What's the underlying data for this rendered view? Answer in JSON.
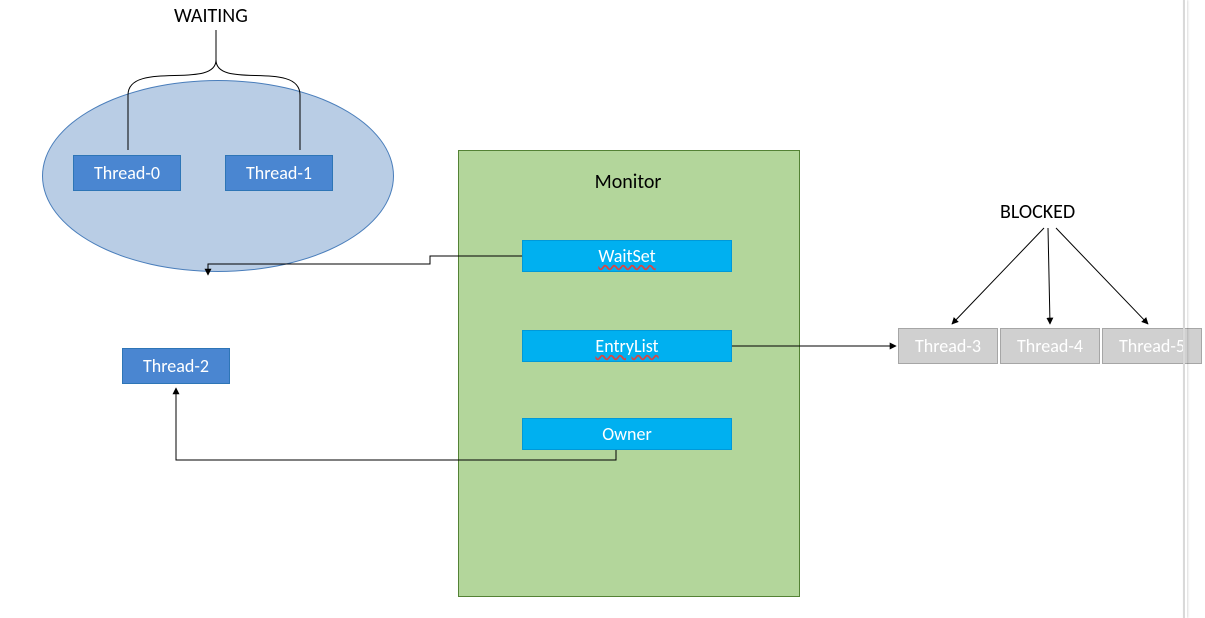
{
  "labels": {
    "waiting": "WAITING",
    "blocked": "BLOCKED",
    "monitor": "Monitor"
  },
  "waitSetGroup": {
    "threads": [
      "Thread-0",
      "Thread-1"
    ]
  },
  "ownerThread": "Thread-2",
  "monitor": {
    "waitset": "WaitSet",
    "entrylist": "EntryList",
    "owner": "Owner"
  },
  "entryListGroup": {
    "threads": [
      "Thread-3",
      "Thread-4",
      "Thread-5"
    ]
  },
  "colors": {
    "ellipseFill": "#b9cde5",
    "ellipseBorder": "#4a7ebb",
    "threadBlueFill": "#4a86d1",
    "threadBlueBorder": "#2e75b6",
    "monitorFill": "#b3d69b",
    "monitorBorder": "#548235",
    "monitorItemFill": "#00b0f0",
    "threadGreyFill": "#d0d0d0",
    "threadGreyBorder": "#a6a6a6"
  }
}
